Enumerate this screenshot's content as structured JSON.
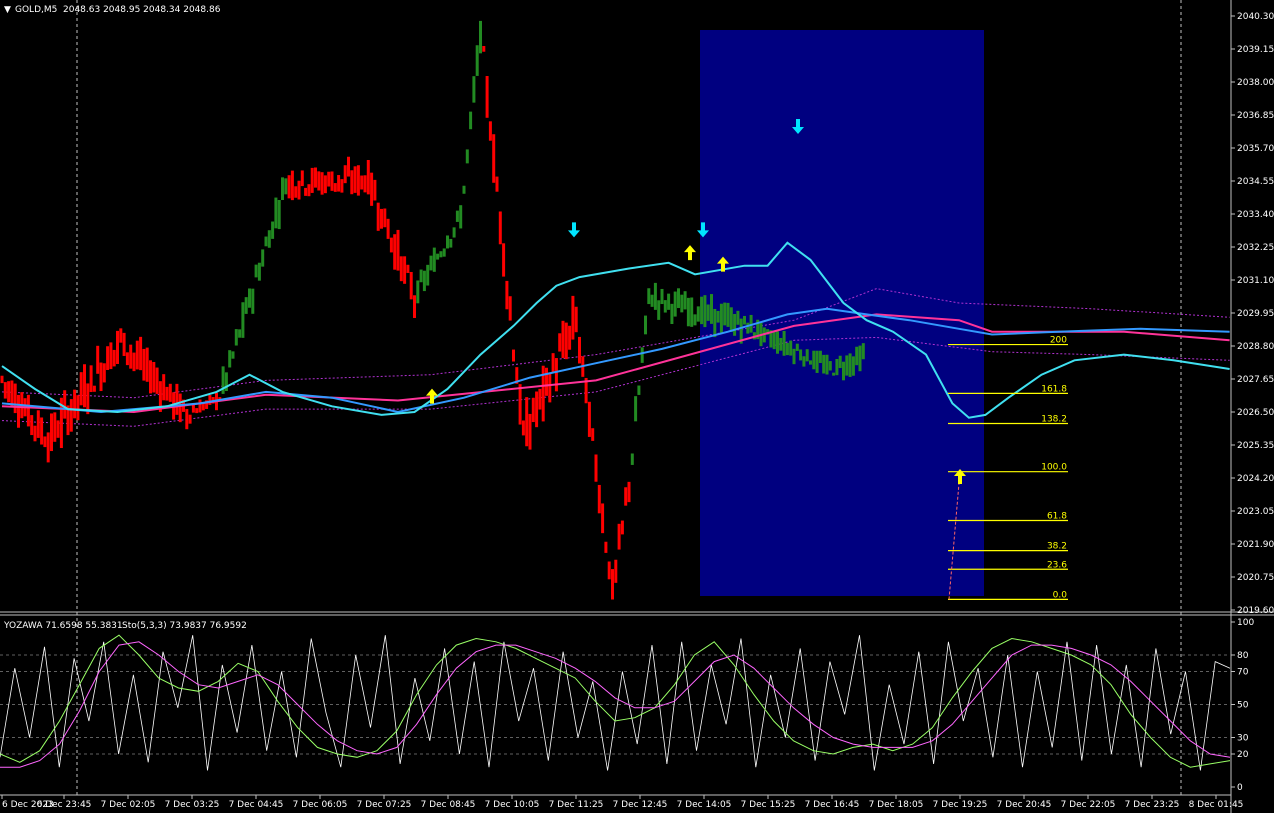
{
  "chart_data": {
    "type": "candlestick",
    "symbol_info": "GOLD,M5",
    "ohlc_header": "2048.63 2048.95 2048.34 2048.86",
    "indicator_header": "YOZAWA 71.6598 55.3831",
    "stoch_header": "Sto(5,3,3) 73.9837 76.9592",
    "price_axis": [
      "2040.30",
      "2039.15",
      "2038.00",
      "2036.85",
      "2035.70",
      "2034.55",
      "2033.40",
      "2032.25",
      "2031.10",
      "2029.95",
      "2028.80",
      "2027.65",
      "2026.50",
      "2025.35",
      "2024.20",
      "2023.05",
      "2021.90",
      "2020.75",
      "2019.60"
    ],
    "ylim": [
      2019.6,
      2040.3
    ],
    "osc_axis": [
      "100",
      "80",
      "70",
      "50",
      "30",
      "20",
      "0"
    ],
    "time_axis": [
      "6 Dec 2023",
      "6 Dec 23:45",
      "7 Dec 02:05",
      "7 Dec 03:25",
      "7 Dec 04:45",
      "7 Dec 06:05",
      "7 Dec 07:25",
      "7 Dec 08:45",
      "7 Dec 10:05",
      "7 Dec 11:25",
      "7 Dec 12:45",
      "7 Dec 14:05",
      "7 Dec 15:25",
      "7 Dec 16:45",
      "7 Dec 18:05",
      "7 Dec 19:25",
      "7 Dec 20:45",
      "7 Dec 22:05",
      "7 Dec 23:25",
      "8 Dec 01:45"
    ],
    "fib_levels": [
      {
        "label": "200",
        "price": 2028.85
      },
      {
        "label": "161.8",
        "price": 2027.15
      },
      {
        "label": "138.2",
        "price": 2026.1
      },
      {
        "label": "100.0",
        "price": 2024.42
      },
      {
        "label": "61.8",
        "price": 2022.72
      },
      {
        "label": "38.2",
        "price": 2021.67
      },
      {
        "label": "23.6",
        "price": 2021.02
      },
      {
        "label": "0.0",
        "price": 2019.97
      }
    ],
    "colors": {
      "bull": "#228B22",
      "bear": "#FF0000",
      "ma_fast": "#40E0F0",
      "ma_slow": "#3399FF",
      "ma_pink": "#FF3399",
      "band": "#B030D0",
      "highlight": "#000080",
      "fib": "#FFFF00",
      "arrow_up": "#FFFF00",
      "arrow_down": "#00E5FF",
      "osc_fast": "#FFFFFF",
      "osc_k": "#99FF66",
      "osc_d": "#FF66FF"
    },
    "signals_up": [
      2027.0,
      2032.0,
      2031.6,
      2024.2
    ],
    "signals_down": [
      2032.9,
      2032.9,
      2036.5
    ],
    "segments": [
      {
        "start": 2027.8,
        "end": 2025.5,
        "bars": 15,
        "dir": "bear",
        "vol": 0.9
      },
      {
        "start": 2025.5,
        "end": 2029.0,
        "bars": 22,
        "dir": "bear",
        "vol": 1.1
      },
      {
        "start": 2029.0,
        "end": 2026.4,
        "bars": 20,
        "dir": "bear",
        "vol": 0.9
      },
      {
        "start": 2026.4,
        "end": 2027.0,
        "bars": 10,
        "dir": "bear",
        "vol": 0.4
      },
      {
        "start": 2027.0,
        "end": 2034.5,
        "bars": 20,
        "dir": "bull",
        "vol": 0.8
      },
      {
        "start": 2034.5,
        "end": 2034.6,
        "bars": 25,
        "dir": "bear",
        "vol": 0.8
      },
      {
        "start": 2034.6,
        "end": 2030.5,
        "bars": 14,
        "dir": "bear",
        "vol": 0.9
      },
      {
        "start": 2030.5,
        "end": 2033.3,
        "bars": 14,
        "dir": "bull",
        "vol": 0.6
      },
      {
        "start": 2033.3,
        "end": 2039.7,
        "bars": 6,
        "dir": "bull",
        "vol": 0.8
      },
      {
        "start": 2039.7,
        "end": 2031.0,
        "bars": 8,
        "dir": "bear",
        "vol": 1.0
      },
      {
        "start": 2031.0,
        "end": 2025.6,
        "bars": 5,
        "dir": "bear",
        "vol": 1.2
      },
      {
        "start": 2025.6,
        "end": 2029.7,
        "bars": 16,
        "dir": "bear",
        "vol": 1.2
      },
      {
        "start": 2029.7,
        "end": 2020.3,
        "bars": 11,
        "dir": "bear",
        "vol": 1.0
      },
      {
        "start": 2020.3,
        "end": 2024.0,
        "bars": 5,
        "dir": "bear",
        "vol": 0.8
      },
      {
        "start": 2024.0,
        "end": 2030.5,
        "bars": 6,
        "dir": "bull",
        "vol": 0.9
      },
      {
        "start": 2030.5,
        "end": 2029.5,
        "bars": 30,
        "dir": "bull",
        "vol": 0.7
      },
      {
        "start": 2029.5,
        "end": 2028.0,
        "bars": 25,
        "dir": "bull",
        "vol": 0.5
      },
      {
        "start": 2028.0,
        "end": 2028.4,
        "bars": 10,
        "dir": "bull",
        "vol": 0.6
      }
    ],
    "ma_fast": [
      [
        0,
        2028.1
      ],
      [
        10,
        2027.3
      ],
      [
        20,
        2026.6
      ],
      [
        35,
        2026.5
      ],
      [
        50,
        2026.7
      ],
      [
        65,
        2027.2
      ],
      [
        75,
        2027.8
      ],
      [
        85,
        2027.2
      ],
      [
        100,
        2026.7
      ],
      [
        115,
        2026.4
      ],
      [
        125,
        2026.5
      ],
      [
        135,
        2027.3
      ],
      [
        145,
        2028.5
      ],
      [
        155,
        2029.5
      ],
      [
        162,
        2030.3
      ],
      [
        168,
        2030.9
      ],
      [
        175,
        2031.2
      ],
      [
        190,
        2031.5
      ],
      [
        202,
        2031.7
      ],
      [
        210,
        2031.3
      ],
      [
        225,
        2031.6
      ],
      [
        232,
        2031.6
      ],
      [
        238,
        2032.4
      ],
      [
        245,
        2031.8
      ],
      [
        255,
        2030.3
      ],
      [
        262,
        2029.7
      ],
      [
        270,
        2029.3
      ],
      [
        280,
        2028.5
      ],
      [
        288,
        2026.8
      ],
      [
        293,
        2026.3
      ],
      [
        298,
        2026.4
      ],
      [
        305,
        2027.0
      ],
      [
        315,
        2027.8
      ],
      [
        325,
        2028.3
      ],
      [
        340,
        2028.5
      ],
      [
        355,
        2028.3
      ],
      [
        372,
        2028.0
      ]
    ],
    "ma_slow": [
      [
        0,
        2026.8
      ],
      [
        30,
        2026.5
      ],
      [
        60,
        2026.8
      ],
      [
        80,
        2027.2
      ],
      [
        100,
        2027.0
      ],
      [
        120,
        2026.5
      ],
      [
        140,
        2027.0
      ],
      [
        160,
        2027.7
      ],
      [
        180,
        2028.2
      ],
      [
        200,
        2028.7
      ],
      [
        220,
        2029.3
      ],
      [
        238,
        2029.9
      ],
      [
        250,
        2030.1
      ],
      [
        262,
        2029.9
      ],
      [
        275,
        2029.7
      ],
      [
        290,
        2029.4
      ],
      [
        300,
        2029.2
      ],
      [
        320,
        2029.3
      ],
      [
        345,
        2029.4
      ],
      [
        372,
        2029.3
      ]
    ],
    "ma_pink": [
      [
        0,
        2026.7
      ],
      [
        40,
        2026.5
      ],
      [
        80,
        2027.1
      ],
      [
        120,
        2026.9
      ],
      [
        180,
        2027.6
      ],
      [
        240,
        2029.5
      ],
      [
        265,
        2029.9
      ],
      [
        290,
        2029.7
      ],
      [
        300,
        2029.3
      ],
      [
        340,
        2029.3
      ],
      [
        372,
        2029.0
      ]
    ],
    "band_upper": [
      [
        0,
        2027.2
      ],
      [
        40,
        2027.0
      ],
      [
        80,
        2027.6
      ],
      [
        130,
        2027.8
      ],
      [
        180,
        2028.5
      ],
      [
        240,
        2029.7
      ],
      [
        265,
        2030.8
      ],
      [
        290,
        2030.3
      ],
      [
        330,
        2030.1
      ],
      [
        372,
        2029.8
      ]
    ],
    "band_lower": [
      [
        0,
        2026.2
      ],
      [
        40,
        2026.0
      ],
      [
        80,
        2026.6
      ],
      [
        130,
        2026.6
      ],
      [
        180,
        2027.2
      ],
      [
        240,
        2029.0
      ],
      [
        265,
        2029.1
      ],
      [
        300,
        2028.6
      ],
      [
        330,
        2028.5
      ],
      [
        372,
        2028.3
      ]
    ],
    "osc_fast": [
      18,
      72,
      30,
      85,
      12,
      78,
      40,
      88,
      20,
      68,
      15,
      82,
      48,
      92,
      10,
      74,
      33,
      86,
      22,
      70,
      18,
      90,
      45,
      12,
      80,
      36,
      92,
      14,
      66,
      28,
      84,
      20,
      76,
      12,
      88,
      40,
      72,
      16,
      82,
      30,
      64,
      10,
      70,
      26,
      86,
      14,
      88,
      22,
      74,
      38,
      90,
      12,
      68,
      30,
      84,
      16,
      76,
      44,
      92,
      10,
      62,
      26,
      82,
      14,
      88,
      40,
      72,
      18,
      80,
      12,
      70,
      24,
      88,
      16,
      86,
      20,
      74,
      12,
      84,
      32,
      70,
      10,
      76,
      72
    ],
    "osc_k": [
      20,
      15,
      22,
      40,
      62,
      84,
      92,
      80,
      66,
      60,
      58,
      64,
      75,
      70,
      52,
      36,
      24,
      20,
      18,
      22,
      34,
      56,
      74,
      86,
      90,
      88,
      84,
      78,
      72,
      66,
      52,
      40,
      42,
      48,
      62,
      80,
      88,
      74,
      56,
      40,
      28,
      22,
      20,
      24,
      26,
      22,
      26,
      36,
      54,
      70,
      84,
      90,
      88,
      84,
      80,
      74,
      62,
      44,
      30,
      18,
      12,
      14,
      16
    ],
    "osc_d": [
      12,
      12,
      16,
      26,
      46,
      70,
      86,
      88,
      80,
      70,
      62,
      60,
      64,
      68,
      62,
      50,
      38,
      28,
      22,
      20,
      24,
      38,
      56,
      72,
      82,
      86,
      86,
      82,
      78,
      72,
      64,
      54,
      48,
      48,
      52,
      64,
      76,
      80,
      72,
      60,
      48,
      38,
      30,
      26,
      24,
      24,
      24,
      28,
      38,
      52,
      66,
      80,
      86,
      86,
      84,
      80,
      74,
      64,
      52,
      40,
      28,
      20,
      18
    ]
  }
}
